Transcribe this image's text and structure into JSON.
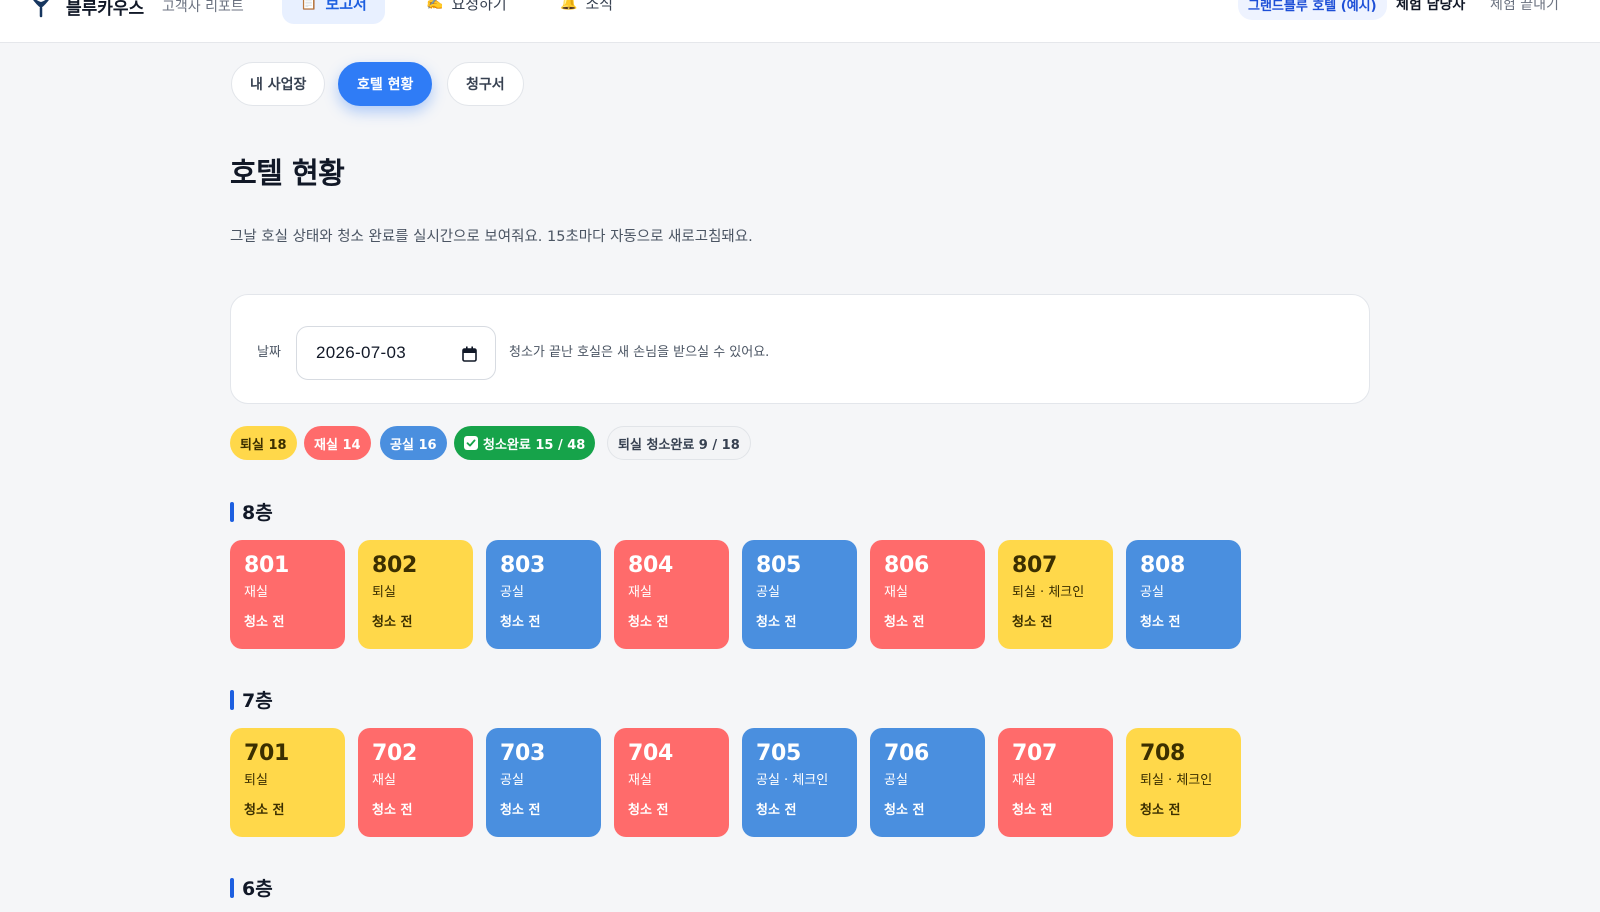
{
  "header": {
    "brand": "블루카우스",
    "brand_sub": "고객사 리포트",
    "nav": [
      {
        "emoji": "📋",
        "label": "보고서",
        "active": true
      },
      {
        "emoji": "✍️",
        "label": "요청하기",
        "active": false
      },
      {
        "emoji": "🔔",
        "label": "소식",
        "active": false
      }
    ],
    "hotel": "그랜드블루 호텔 (예시)",
    "user": "체험 담당자",
    "end_link": "체험 끝내기"
  },
  "subtabs": [
    {
      "label": "내 사업장",
      "active": false
    },
    {
      "label": "호텔 현황",
      "active": true
    },
    {
      "label": "청구서",
      "active": false
    }
  ],
  "page": {
    "title": "호텔 현황",
    "description": "그날 호실 상태와 청소 완료를 실시간으로 보여줘요. 15초마다 자동으로 새로고침돼요."
  },
  "date_card": {
    "label": "날짜",
    "value": "2026-07-03",
    "hint": "청소가 끝난 호실은 새 손님을 받으실 수 있어요."
  },
  "summary": {
    "checkout": "퇴실 18",
    "occupied": "재실 14",
    "vacant": "공실 16",
    "cleaned": "청소완료 15 / 48",
    "checkout_cleaned": "퇴실 청소완료 9 / 18"
  },
  "colors": {
    "occupied": "#ff6b6b",
    "checkout": "#ffd84a",
    "vacant": "#4a8fdf",
    "cleaned": "#16a34a",
    "accent": "#2f7cf6"
  },
  "floors": [
    {
      "label": "8층",
      "rooms": [
        {
          "number": "801",
          "status": "재실",
          "clean": "청소 전",
          "type": "occupied"
        },
        {
          "number": "802",
          "status": "퇴실",
          "clean": "청소 전",
          "type": "checkout"
        },
        {
          "number": "803",
          "status": "공실",
          "clean": "청소 전",
          "type": "vacant"
        },
        {
          "number": "804",
          "status": "재실",
          "clean": "청소 전",
          "type": "occupied"
        },
        {
          "number": "805",
          "status": "공실",
          "clean": "청소 전",
          "type": "vacant"
        },
        {
          "number": "806",
          "status": "재실",
          "clean": "청소 전",
          "type": "occupied"
        },
        {
          "number": "807",
          "status": "퇴실 · 체크인",
          "clean": "청소 전",
          "type": "checkout"
        },
        {
          "number": "808",
          "status": "공실",
          "clean": "청소 전",
          "type": "vacant"
        }
      ]
    },
    {
      "label": "7층",
      "rooms": [
        {
          "number": "701",
          "status": "퇴실",
          "clean": "청소 전",
          "type": "checkout"
        },
        {
          "number": "702",
          "status": "재실",
          "clean": "청소 전",
          "type": "occupied"
        },
        {
          "number": "703",
          "status": "공실",
          "clean": "청소 전",
          "type": "vacant"
        },
        {
          "number": "704",
          "status": "재실",
          "clean": "청소 전",
          "type": "occupied"
        },
        {
          "number": "705",
          "status": "공실 · 체크인",
          "clean": "청소 전",
          "type": "vacant"
        },
        {
          "number": "706",
          "status": "공실",
          "clean": "청소 전",
          "type": "vacant"
        },
        {
          "number": "707",
          "status": "재실",
          "clean": "청소 전",
          "type": "occupied"
        },
        {
          "number": "708",
          "status": "퇴실 · 체크인",
          "clean": "청소 전",
          "type": "checkout"
        }
      ]
    },
    {
      "label": "6층",
      "rooms": []
    }
  ]
}
